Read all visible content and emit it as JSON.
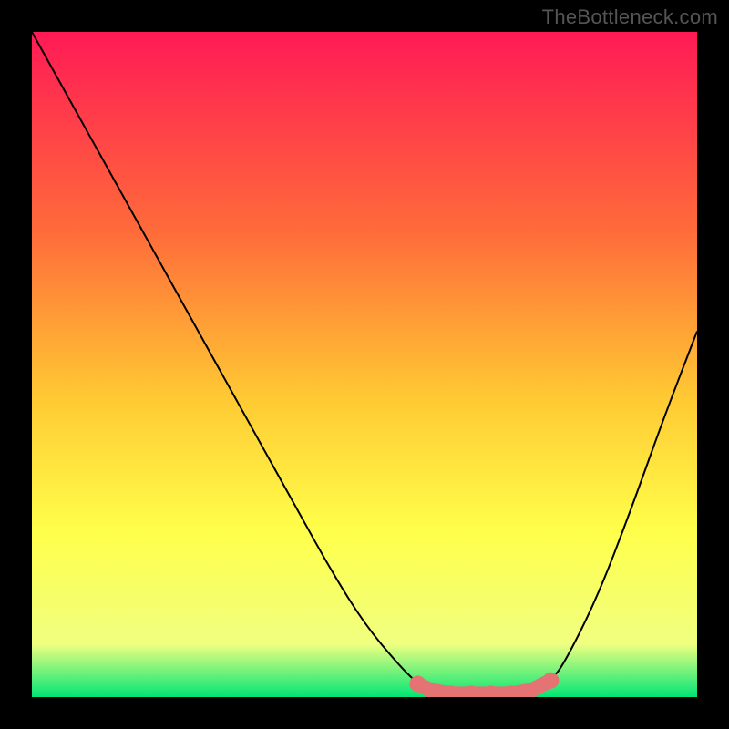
{
  "watermark": "TheBottleneck.com",
  "colors": {
    "bg": "#000000",
    "gradient_top": "#ff1a55",
    "gradient_mid1": "#ff6b3a",
    "gradient_mid2": "#ffc933",
    "gradient_mid3": "#ffff4a",
    "gradient_mid4": "#f0ff80",
    "gradient_bottom": "#00e676",
    "curve": "#000000",
    "marker": "#e57373"
  },
  "chart_data": {
    "type": "line",
    "title": "",
    "xlabel": "",
    "ylabel": "",
    "xlim": [
      0,
      100
    ],
    "ylim": [
      0,
      100
    ],
    "curve_points": [
      {
        "x": 0,
        "y": 100
      },
      {
        "x": 5,
        "y": 91
      },
      {
        "x": 10,
        "y": 82
      },
      {
        "x": 15,
        "y": 73
      },
      {
        "x": 20,
        "y": 64
      },
      {
        "x": 25,
        "y": 55
      },
      {
        "x": 30,
        "y": 46
      },
      {
        "x": 35,
        "y": 37
      },
      {
        "x": 40,
        "y": 28
      },
      {
        "x": 45,
        "y": 19
      },
      {
        "x": 50,
        "y": 11
      },
      {
        "x": 55,
        "y": 5
      },
      {
        "x": 58,
        "y": 2
      },
      {
        "x": 60,
        "y": 1
      },
      {
        "x": 65,
        "y": 0.5
      },
      {
        "x": 70,
        "y": 0.5
      },
      {
        "x": 75,
        "y": 1
      },
      {
        "x": 78,
        "y": 2.5
      },
      {
        "x": 80,
        "y": 5
      },
      {
        "x": 85,
        "y": 15
      },
      {
        "x": 90,
        "y": 28
      },
      {
        "x": 95,
        "y": 42
      },
      {
        "x": 100,
        "y": 55
      }
    ],
    "marker_points": [
      {
        "x": 58,
        "y": 2.0
      },
      {
        "x": 60,
        "y": 1.0
      },
      {
        "x": 63,
        "y": 0.5
      },
      {
        "x": 66,
        "y": 0.5
      },
      {
        "x": 69,
        "y": 0.5
      },
      {
        "x": 72,
        "y": 0.5
      },
      {
        "x": 75,
        "y": 1.0
      },
      {
        "x": 78,
        "y": 2.5
      }
    ]
  }
}
